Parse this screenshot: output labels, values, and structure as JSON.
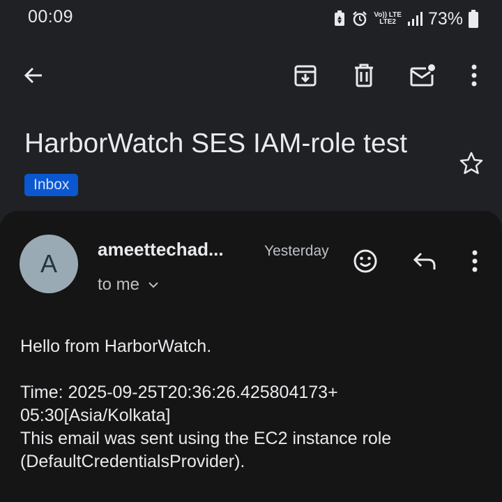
{
  "status_bar": {
    "time": "00:09",
    "network_top": "Vo)) LTE",
    "network_bottom": "LTE2",
    "battery_percent": "73%"
  },
  "toolbar": {
    "back_icon": "arrow-left-icon",
    "archive_icon": "archive-icon",
    "delete_icon": "trash-icon",
    "mark_unread_icon": "mail-unread-icon",
    "more_icon": "more-vert-icon"
  },
  "email": {
    "subject": "HarborWatch SES IAM-role test",
    "label": "Inbox",
    "sender_initial": "A",
    "sender": "ameettechad...",
    "date": "Yesterday",
    "recipient": "to me",
    "body": {
      "line1": "Hello from HarborWatch.",
      "line2": "Time: 2025-09-25T20:36:26.425804173+",
      "line3": "05:30[Asia/Kolkata]",
      "line4": "This email was sent using the EC2 instance role",
      "line5": "(DefaultCredentialsProvider)."
    }
  },
  "colors": {
    "background": "#202124",
    "card": "#151515",
    "chip": "#0b57d0",
    "avatar": "#9aaab4"
  }
}
